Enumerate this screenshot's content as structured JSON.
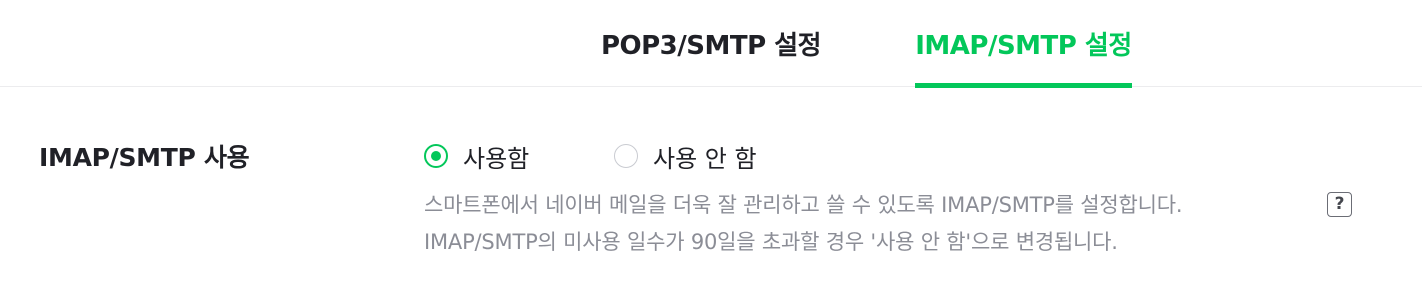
{
  "tabs": {
    "pop3_label": "POP3/SMTP 설정",
    "imap_label": "IMAP/SMTP 설정",
    "active": "IMAP/SMTP 설정"
  },
  "setting": {
    "label": "IMAP/SMTP 사용",
    "options": [
      {
        "label": "사용함",
        "selected": true
      },
      {
        "label": "사용 안 함",
        "selected": false
      }
    ],
    "description_line1": "스마트폰에서 네이버 메일을 더욱 잘 관리하고 쓸 수 있도록 IMAP/SMTP를 설정합니다.",
    "description_line2": "IMAP/SMTP의 미사용 일수가 90일을 초과할 경우 '사용 안 함'으로 변경됩니다.",
    "help_icon": "?"
  },
  "colors": {
    "accent": "#03c75a",
    "text": "#202127",
    "muted": "#8b8d96"
  }
}
